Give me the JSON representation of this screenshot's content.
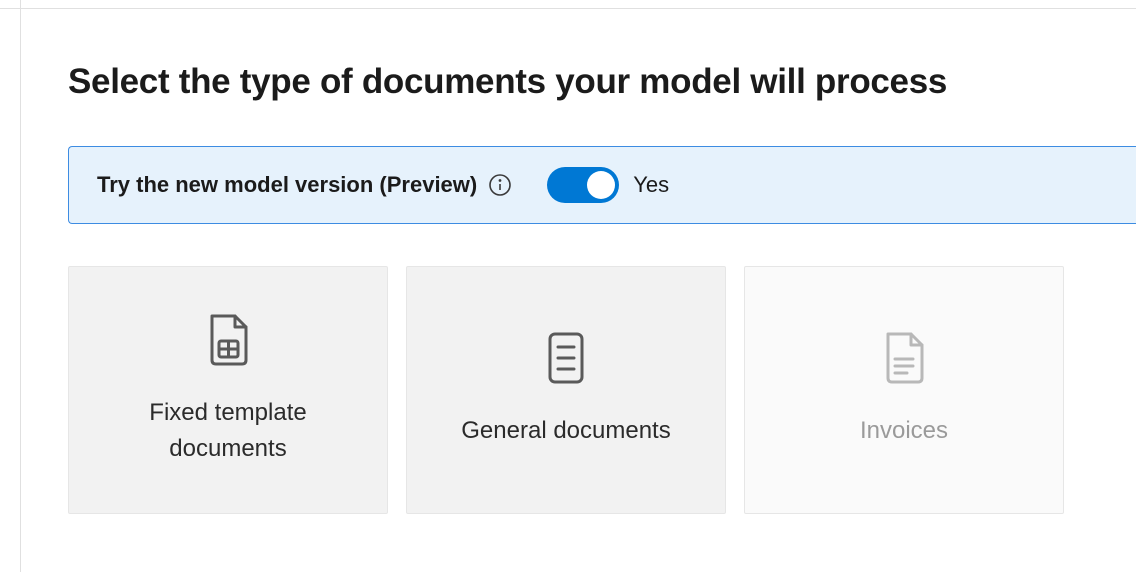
{
  "page": {
    "title": "Select the type of documents your model will process"
  },
  "preview_banner": {
    "label": "Try the new model version (Preview)",
    "toggle_status": "Yes",
    "toggle_on": true
  },
  "document_types": [
    {
      "label": "Fixed template documents",
      "icon": "fixed-template-document-icon",
      "enabled": true
    },
    {
      "label": "General documents",
      "icon": "general-document-icon",
      "enabled": true
    },
    {
      "label": "Invoices",
      "icon": "invoice-document-icon",
      "enabled": false
    }
  ]
}
